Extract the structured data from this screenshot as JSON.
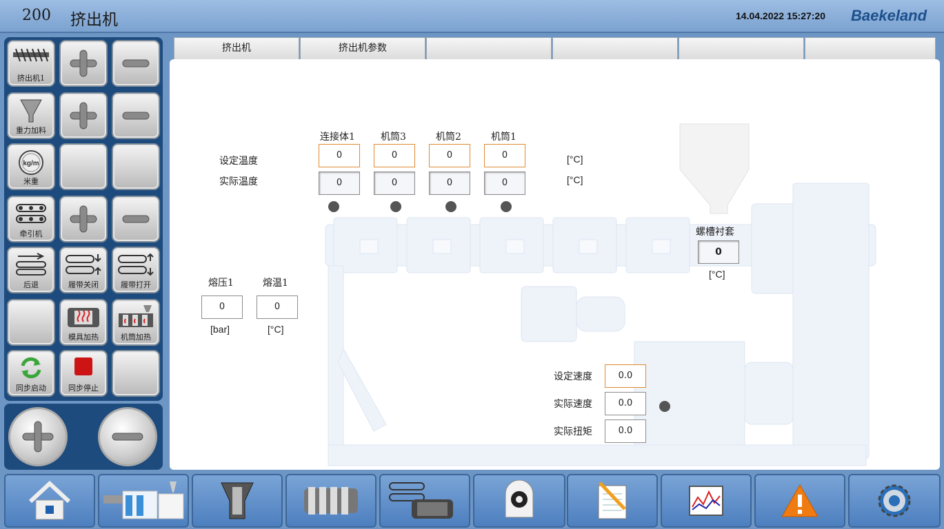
{
  "header": {
    "id": "200",
    "title": "挤出机",
    "datetime": "14.04.2022 15:27:20",
    "brand": "Baekeland"
  },
  "left_buttons": [
    {
      "label": "挤出机1",
      "icon": "extruder-screw-icon"
    },
    {
      "label": "",
      "icon": "plus-icon"
    },
    {
      "label": "",
      "icon": "minus-icon"
    },
    {
      "label": "重力加料",
      "icon": "gravity-feeder-icon"
    },
    {
      "label": "",
      "icon": "plus-icon"
    },
    {
      "label": "",
      "icon": "minus-icon"
    },
    {
      "label": "米重",
      "icon": "kg-per-meter-gauge-icon"
    },
    {
      "label": "",
      "icon": ""
    },
    {
      "label": "",
      "icon": ""
    },
    {
      "label": "牵引机",
      "icon": "haul-off-icon"
    },
    {
      "label": "",
      "icon": "plus-icon"
    },
    {
      "label": "",
      "icon": "minus-icon"
    },
    {
      "label": "后退",
      "icon": "belt-back-icon"
    },
    {
      "label": "履带关闭",
      "icon": "belt-close-icon"
    },
    {
      "label": "履带打开",
      "icon": "belt-open-icon"
    },
    {
      "label": "",
      "icon": ""
    },
    {
      "label": "模具加热",
      "icon": "die-heating-icon"
    },
    {
      "label": "机筒加热",
      "icon": "barrel-heating-icon"
    },
    {
      "label": "同步启动",
      "icon": "sync-start-icon"
    },
    {
      "label": "同步停止",
      "icon": "sync-stop-icon"
    },
    {
      "label": "",
      "icon": ""
    }
  ],
  "tabs": [
    "挤出机",
    "挤出机参数",
    "",
    "",
    "",
    ""
  ],
  "zones": {
    "headers": [
      "连接体1",
      "机筒3",
      "机筒2",
      "机筒1"
    ],
    "set_label": "设定温度",
    "actual_label": "实际温度",
    "set_values": [
      "0",
      "0",
      "0",
      "0"
    ],
    "actual_values": [
      "0",
      "0",
      "0",
      "0"
    ],
    "unit": "[°C]"
  },
  "melt": {
    "pressure_label": "熔压1",
    "temp_label": "熔温1",
    "pressure_value": "0",
    "temp_value": "0",
    "pressure_unit": "[bar]",
    "temp_unit": "[°C]"
  },
  "feed_bush": {
    "label": "螺槽衬套",
    "value": "0",
    "unit": "[°C]"
  },
  "drive": {
    "set_speed_label": "设定速度",
    "actual_speed_label": "实际速度",
    "actual_torque_label": "实际扭矩",
    "set_speed": "0.0",
    "actual_speed": "0.0",
    "actual_torque": "0.0"
  },
  "nav": [
    "home-icon",
    "extrusion-line-icon",
    "feeder-icon",
    "barrel-heater-icon",
    "haul-off-motor-icon",
    "cutter-icon",
    "notes-icon",
    "trend-chart-icon",
    "alarm-icon",
    "settings-icon"
  ],
  "colors": {
    "set_border": "#e0892f",
    "panel": "#1d4b7d",
    "header": "#7ba2d0"
  }
}
